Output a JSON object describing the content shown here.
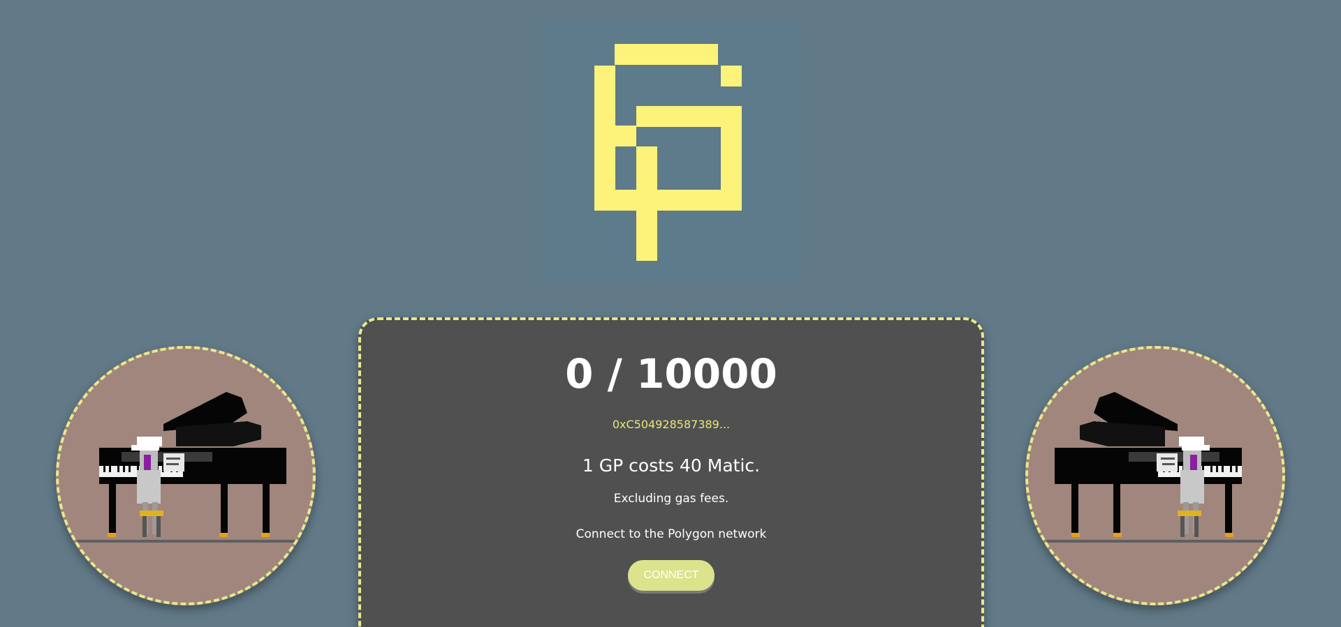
{
  "logo": {
    "icon": "gp-pixel-logo-icon",
    "color": "#fdf27a",
    "background": "#5d7b8a"
  },
  "mint": {
    "counter": "0 / 10000",
    "contract_address": "0xC504928587389...",
    "cost_text": "1 GP costs 40 Matic.",
    "gas_text": "Excluding gas fees.",
    "network_text": "Connect to the Polygon network",
    "connect_label": "CONNECT"
  },
  "avatars": [
    {
      "icon": "piano-player-icon"
    },
    {
      "icon": "piano-player-icon"
    }
  ],
  "colors": {
    "background": "#627a88",
    "card": "#505050",
    "accent_border": "#e8e88c",
    "address_text": "#e6e87a",
    "button": "#dbe48c",
    "avatar_bg": "#a0867d"
  }
}
